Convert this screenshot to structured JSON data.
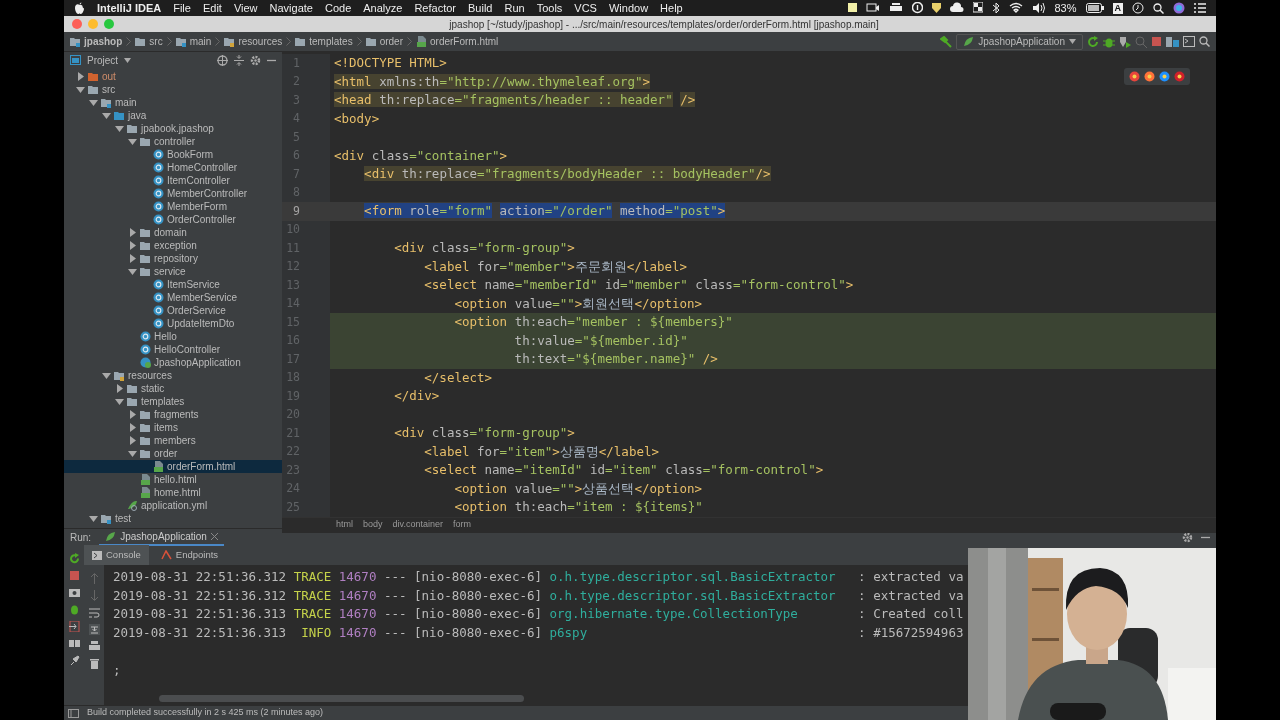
{
  "menu_bar": {
    "app": "IntelliJ IDEA",
    "items": [
      "File",
      "Edit",
      "View",
      "Navigate",
      "Code",
      "Analyze",
      "Refactor",
      "Build",
      "Run",
      "Tools",
      "VCS",
      "Window",
      "Help"
    ],
    "battery": "83%",
    "input_source": "A"
  },
  "window": {
    "title": "jpashop [~/study/jpashop] - .../src/main/resources/templates/order/orderForm.html [jpashop.main]"
  },
  "breadcrumbs": [
    {
      "label": "jpashop",
      "kind": "module"
    },
    {
      "label": "src",
      "kind": "folder"
    },
    {
      "label": "main",
      "kind": "module"
    },
    {
      "label": "resources",
      "kind": "resources"
    },
    {
      "label": "templates",
      "kind": "folder"
    },
    {
      "label": "order",
      "kind": "folder"
    },
    {
      "label": "orderForm.html",
      "kind": "html"
    }
  ],
  "run_config": {
    "label": "JpashopApplication"
  },
  "project": {
    "title": "Project",
    "tree": [
      {
        "label": "out",
        "kind": "excluded",
        "expanded": false,
        "selected": false
      },
      {
        "label": "src",
        "kind": "folder",
        "expanded": true,
        "selected": false,
        "children": [
          {
            "label": "main",
            "kind": "source",
            "expanded": true,
            "selected": false,
            "children": [
              {
                "label": "java",
                "kind": "java",
                "expanded": true,
                "selected": false,
                "children": [
                  {
                    "label": "jpabook.jpashop",
                    "kind": "package",
                    "expanded": true,
                    "selected": false,
                    "children": [
                      {
                        "label": "controller",
                        "kind": "package",
                        "expanded": true,
                        "selected": false,
                        "children": [
                          {
                            "label": "BookForm",
                            "kind": "class",
                            "selected": false
                          },
                          {
                            "label": "HomeController",
                            "kind": "class",
                            "selected": false
                          },
                          {
                            "label": "ItemController",
                            "kind": "class",
                            "selected": false
                          },
                          {
                            "label": "MemberController",
                            "kind": "class",
                            "selected": false
                          },
                          {
                            "label": "MemberForm",
                            "kind": "class",
                            "selected": false
                          },
                          {
                            "label": "OrderController",
                            "kind": "class",
                            "selected": false
                          }
                        ]
                      },
                      {
                        "label": "domain",
                        "kind": "package",
                        "expanded": false,
                        "selected": false
                      },
                      {
                        "label": "exception",
                        "kind": "package",
                        "expanded": false,
                        "selected": false
                      },
                      {
                        "label": "repository",
                        "kind": "package",
                        "expanded": false,
                        "selected": false
                      },
                      {
                        "label": "service",
                        "kind": "package",
                        "expanded": true,
                        "selected": false,
                        "children": [
                          {
                            "label": "ItemService",
                            "kind": "class",
                            "selected": false
                          },
                          {
                            "label": "MemberService",
                            "kind": "class",
                            "selected": false
                          },
                          {
                            "label": "OrderService",
                            "kind": "class",
                            "selected": false
                          },
                          {
                            "label": "UpdateItemDto",
                            "kind": "class",
                            "selected": false
                          }
                        ]
                      },
                      {
                        "label": "Hello",
                        "kind": "class",
                        "selected": false
                      },
                      {
                        "label": "HelloController",
                        "kind": "class",
                        "selected": false
                      },
                      {
                        "label": "JpashopApplication",
                        "kind": "app",
                        "selected": false
                      }
                    ]
                  }
                ]
              },
              {
                "label": "resources",
                "kind": "resources",
                "expanded": true,
                "selected": false,
                "children": [
                  {
                    "label": "static",
                    "kind": "package",
                    "expanded": false,
                    "selected": false
                  },
                  {
                    "label": "templates",
                    "kind": "package",
                    "expanded": true,
                    "selected": false,
                    "children": [
                      {
                        "label": "fragments",
                        "kind": "package",
                        "expanded": false,
                        "selected": false
                      },
                      {
                        "label": "items",
                        "kind": "package",
                        "expanded": false,
                        "selected": false
                      },
                      {
                        "label": "members",
                        "kind": "package",
                        "expanded": false,
                        "selected": false
                      },
                      {
                        "label": "order",
                        "kind": "package",
                        "expanded": true,
                        "selected": false,
                        "children": [
                          {
                            "label": "orderForm.html",
                            "kind": "html",
                            "selected": true
                          }
                        ]
                      },
                      {
                        "label": "hello.html",
                        "kind": "html",
                        "selected": false
                      },
                      {
                        "label": "home.html",
                        "kind": "html",
                        "selected": false
                      }
                    ]
                  },
                  {
                    "label": "application.yml",
                    "kind": "yml",
                    "selected": false
                  }
                ]
              }
            ]
          },
          {
            "label": "test",
            "kind": "source",
            "expanded": true,
            "selected": false
          }
        ]
      }
    ]
  },
  "editor": {
    "lines": [
      {
        "number": "1",
        "selected": false,
        "shaded": false,
        "tokens": [
          {
            "kind": "tag",
            "text": "<!DOCTYPE HTML>"
          }
        ]
      },
      {
        "number": "2",
        "selected": false,
        "shaded": false,
        "tokens": [
          {
            "kind": "tag",
            "text": "<html ",
            "shaded": true
          },
          {
            "kind": "attr",
            "text": "xmlns:th",
            "shaded": true
          },
          {
            "kind": "value",
            "text": "=\"http://www.thymeleaf.org\"",
            "shaded": true
          },
          {
            "kind": "tag",
            "text": ">",
            "shaded": true
          }
        ]
      },
      {
        "number": "3",
        "selected": false,
        "shaded": false,
        "tokens": [
          {
            "kind": "tag",
            "text": "<head ",
            "shaded": true
          },
          {
            "kind": "attr",
            "text": "th:replace",
            "shaded": true
          },
          {
            "kind": "value",
            "text": "=\"fragments/header :: header\"",
            "shaded": true
          },
          {
            "kind": "tag",
            "text": " />",
            "shaded": true
          }
        ]
      },
      {
        "number": "4",
        "selected": false,
        "shaded": false,
        "tokens": [
          {
            "kind": "tag",
            "text": "<body>"
          }
        ]
      },
      {
        "number": "5",
        "selected": false,
        "shaded": false
      },
      {
        "number": "6",
        "selected": false,
        "shaded": false,
        "tokens": [
          {
            "kind": "tag",
            "text": "<div "
          },
          {
            "kind": "attr",
            "text": "class"
          },
          {
            "kind": "value",
            "text": "=\"container\""
          },
          {
            "kind": "tag",
            "text": ">"
          }
        ]
      },
      {
        "number": "7",
        "selected": false,
        "shaded": false,
        "tokens": [
          {
            "kind": "tag",
            "text": "    <div ",
            "shaded": true
          },
          {
            "kind": "attr",
            "text": "th:replace",
            "shaded": true
          },
          {
            "kind": "value",
            "text": "=\"fragments/bodyHeader :: bodyHeader\"",
            "shaded": true
          },
          {
            "kind": "tag",
            "text": "/>",
            "shaded": true
          }
        ]
      },
      {
        "number": "8",
        "selected": false,
        "shaded": false
      },
      {
        "number": "9",
        "selected": true,
        "shaded": false,
        "tokens": [
          {
            "kind": "tag",
            "text": "    <form ",
            "shaded": true
          },
          {
            "kind": "attr",
            "text": "role",
            "shaded": true
          },
          {
            "kind": "value",
            "text": "=\"form\"",
            "shaded": true
          },
          {
            "kind": "attr",
            "text": " action",
            "shaded": true
          },
          {
            "kind": "value",
            "text": "=\"/order\"",
            "shaded": true
          },
          {
            "kind": "attr",
            "text": " method",
            "shaded": true
          },
          {
            "kind": "value",
            "text": "=\"post\"",
            "shaded": true
          },
          {
            "kind": "tag",
            "text": ">",
            "shaded": true
          }
        ]
      },
      {
        "number": "10",
        "selected": false,
        "shaded": false
      },
      {
        "number": "11",
        "selected": false,
        "shaded": false,
        "tokens": [
          {
            "kind": "tag",
            "text": "        <div "
          },
          {
            "kind": "attr",
            "text": "class"
          },
          {
            "kind": "value",
            "text": "=\"form-group\""
          },
          {
            "kind": "tag",
            "text": ">"
          }
        ]
      },
      {
        "number": "12",
        "selected": false,
        "shaded": false,
        "tokens": [
          {
            "kind": "tag",
            "text": "            <label "
          },
          {
            "kind": "attr",
            "text": "for"
          },
          {
            "kind": "value",
            "text": "=\"member\""
          },
          {
            "kind": "tag",
            "text": ">"
          },
          {
            "kind": "text",
            "text": "주문회원"
          },
          {
            "kind": "tag",
            "text": "</label>"
          }
        ]
      },
      {
        "number": "13",
        "selected": false,
        "shaded": false,
        "tokens": [
          {
            "kind": "tag",
            "text": "            <select "
          },
          {
            "kind": "attr",
            "text": "name"
          },
          {
            "kind": "value",
            "text": "=\"memberId\""
          },
          {
            "kind": "attr",
            "text": " id"
          },
          {
            "kind": "value",
            "text": "=\"member\""
          },
          {
            "kind": "attr",
            "text": " class"
          },
          {
            "kind": "value",
            "text": "=\"form-control\""
          },
          {
            "kind": "tag",
            "text": ">"
          }
        ]
      },
      {
        "number": "14",
        "selected": false,
        "shaded": false,
        "tokens": [
          {
            "kind": "tag",
            "text": "                <option "
          },
          {
            "kind": "attr",
            "text": "value"
          },
          {
            "kind": "value",
            "text": "=\"\""
          },
          {
            "kind": "tag",
            "text": ">"
          },
          {
            "kind": "text",
            "text": "회원선택"
          },
          {
            "kind": "tag",
            "text": "</option>"
          }
        ]
      },
      {
        "number": "15",
        "selected": false,
        "shaded": true,
        "tokens": [
          {
            "kind": "tag",
            "text": "                <option "
          },
          {
            "kind": "attr",
            "text": "th:each"
          },
          {
            "kind": "value",
            "text": "=\"member : ${members}\""
          }
        ]
      },
      {
        "number": "16",
        "selected": false,
        "shaded": true,
        "tokens": [
          {
            "kind": "attr",
            "text": "                        th:value"
          },
          {
            "kind": "value",
            "text": "=\"${member.id}\""
          }
        ]
      },
      {
        "number": "17",
        "selected": false,
        "shaded": true,
        "tokens": [
          {
            "kind": "attr",
            "text": "                        th:text"
          },
          {
            "kind": "value",
            "text": "=\"${member.name}\""
          },
          {
            "kind": "tag",
            "text": " />"
          }
        ]
      },
      {
        "number": "18",
        "selected": false,
        "shaded": false,
        "tokens": [
          {
            "kind": "tag",
            "text": "            </select>"
          }
        ]
      },
      {
        "number": "19",
        "selected": false,
        "shaded": false,
        "tokens": [
          {
            "kind": "tag",
            "text": "        </div>"
          }
        ]
      },
      {
        "number": "20",
        "selected": false,
        "shaded": false
      },
      {
        "number": "21",
        "selected": false,
        "shaded": false,
        "tokens": [
          {
            "kind": "tag",
            "text": "        <div "
          },
          {
            "kind": "attr",
            "text": "class"
          },
          {
            "kind": "value",
            "text": "=\"form-group\""
          },
          {
            "kind": "tag",
            "text": ">"
          }
        ]
      },
      {
        "number": "22",
        "selected": false,
        "shaded": false,
        "tokens": [
          {
            "kind": "tag",
            "text": "            <label "
          },
          {
            "kind": "attr",
            "text": "for"
          },
          {
            "kind": "value",
            "text": "=\"item\""
          },
          {
            "kind": "tag",
            "text": ">"
          },
          {
            "kind": "text",
            "text": "상품명"
          },
          {
            "kind": "tag",
            "text": "</label>"
          }
        ]
      },
      {
        "number": "23",
        "selected": false,
        "shaded": false,
        "tokens": [
          {
            "kind": "tag",
            "text": "            <select "
          },
          {
            "kind": "attr",
            "text": "name"
          },
          {
            "kind": "value",
            "text": "=\"itemId\""
          },
          {
            "kind": "attr",
            "text": " id"
          },
          {
            "kind": "value",
            "text": "=\"item\""
          },
          {
            "kind": "attr",
            "text": " class"
          },
          {
            "kind": "value",
            "text": "=\"form-control\""
          },
          {
            "kind": "tag",
            "text": ">"
          }
        ]
      },
      {
        "number": "24",
        "selected": false,
        "shaded": false,
        "tokens": [
          {
            "kind": "tag",
            "text": "                <option "
          },
          {
            "kind": "attr",
            "text": "value"
          },
          {
            "kind": "value",
            "text": "=\"\""
          },
          {
            "kind": "tag",
            "text": ">"
          },
          {
            "kind": "text",
            "text": "상품선택"
          },
          {
            "kind": "tag",
            "text": "</option>"
          }
        ]
      },
      {
        "number": "25",
        "selected": false,
        "shaded": false,
        "tokens": [
          {
            "kind": "tag",
            "text": "                <option "
          },
          {
            "kind": "attr",
            "text": "th:each"
          },
          {
            "kind": "value",
            "text": "=\"item : ${items}\""
          }
        ]
      }
    ],
    "path": [
      "html",
      "body",
      "div.container",
      "form"
    ]
  },
  "run": {
    "label": "Run:",
    "tab": "JpashopApplication",
    "tabs": [
      {
        "label": "Console",
        "selected": true
      },
      {
        "label": "Endpoints",
        "selected": false
      }
    ],
    "console": [
      {
        "kind": "log",
        "time": "2019-08-31 22:51:36.312",
        "level": "TRACE",
        "pid": "14670",
        "sep": "---",
        "thread": "[nio-8080-exec-6]",
        "logger": "o.h.type.descriptor.sql.BasicExtractor",
        "message": ": extracted va"
      },
      {
        "kind": "log",
        "time": "2019-08-31 22:51:36.312",
        "level": "TRACE",
        "pid": "14670",
        "sep": "---",
        "thread": "[nio-8080-exec-6]",
        "logger": "o.h.type.descriptor.sql.BasicExtractor",
        "message": ": extracted va"
      },
      {
        "kind": "log",
        "time": "2019-08-31 22:51:36.313",
        "level": "TRACE",
        "pid": "14670",
        "sep": "---",
        "thread": "[nio-8080-exec-6]",
        "logger": "org.hibernate.type.CollectionType",
        "message": ": Created coll"
      },
      {
        "kind": "log",
        "time": "2019-08-31 22:51:36.313",
        "level": "INFO",
        "pid": "14670",
        "sep": "---",
        "thread": "[nio-8080-exec-6]",
        "logger": "p6spy",
        "message": ": #15672594963"
      },
      {
        "kind": "blank"
      },
      {
        "kind": "text",
        "text": ";"
      }
    ]
  },
  "status_bar": "Build completed successfully in 2 s 425 ms (2 minutes ago)"
}
